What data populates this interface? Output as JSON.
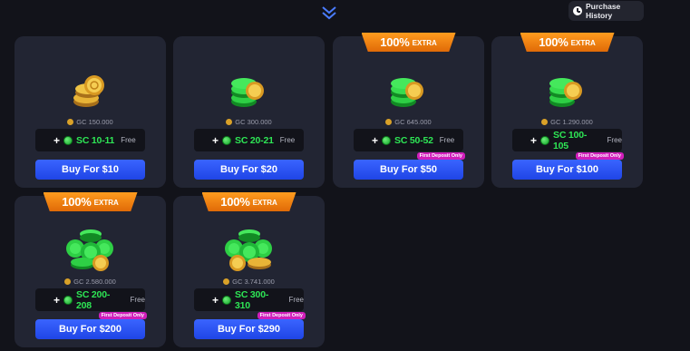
{
  "header": {
    "chevron_icon": "double-chevron-down-icon",
    "purchase_history_label": "Purchase History",
    "purchase_history_icon": "clock-icon"
  },
  "colors": {
    "background": "#12131a",
    "card": "#222533",
    "buy_button": "#2a55f5",
    "sc_green": "#2ee655",
    "ribbon_orange": "#f28713",
    "badge_pink": "#d11ebb"
  },
  "packages": [
    {
      "ribbon": null,
      "gc": "GC 150.000",
      "sc": "SC 10-11",
      "free": "Free",
      "buy": "Buy For $10",
      "badge": null,
      "art": "gold-coin-stack-icon"
    },
    {
      "ribbon": null,
      "gc": "GC 300.000",
      "sc": "SC 20-21",
      "free": "Free",
      "buy": "Buy For $20",
      "badge": null,
      "art": "green-and-gold-coin-stack-icon"
    },
    {
      "ribbon": {
        "pct": "100%",
        "extra": "EXTRA"
      },
      "gc": "GC 645.000",
      "sc": "SC 50-52",
      "free": "Free",
      "buy": "Buy For $50",
      "badge": "First Deposit Only",
      "art": "green-and-gold-coin-stack-icon"
    },
    {
      "ribbon": {
        "pct": "100%",
        "extra": "EXTRA"
      },
      "gc": "GC 1.290.000",
      "sc": "SC 100-105",
      "free": "Free",
      "buy": "Buy For $100",
      "badge": "First Deposit Only",
      "art": "green-and-gold-coin-stack-icon"
    },
    {
      "ribbon": {
        "pct": "100%",
        "extra": "EXTRA"
      },
      "gc": "GC 2.580.000",
      "sc": "SC 200-208",
      "free": "Free",
      "buy": "Buy For $200",
      "badge": "First Deposit Only",
      "art": "large-green-coin-pile-icon"
    },
    {
      "ribbon": {
        "pct": "100%",
        "extra": "EXTRA"
      },
      "gc": "GC 3.741.000",
      "sc": "SC 300-310",
      "free": "Free",
      "buy": "Buy For $290",
      "badge": "First Deposit Only",
      "art": "large-green-coin-pile-icon"
    }
  ]
}
